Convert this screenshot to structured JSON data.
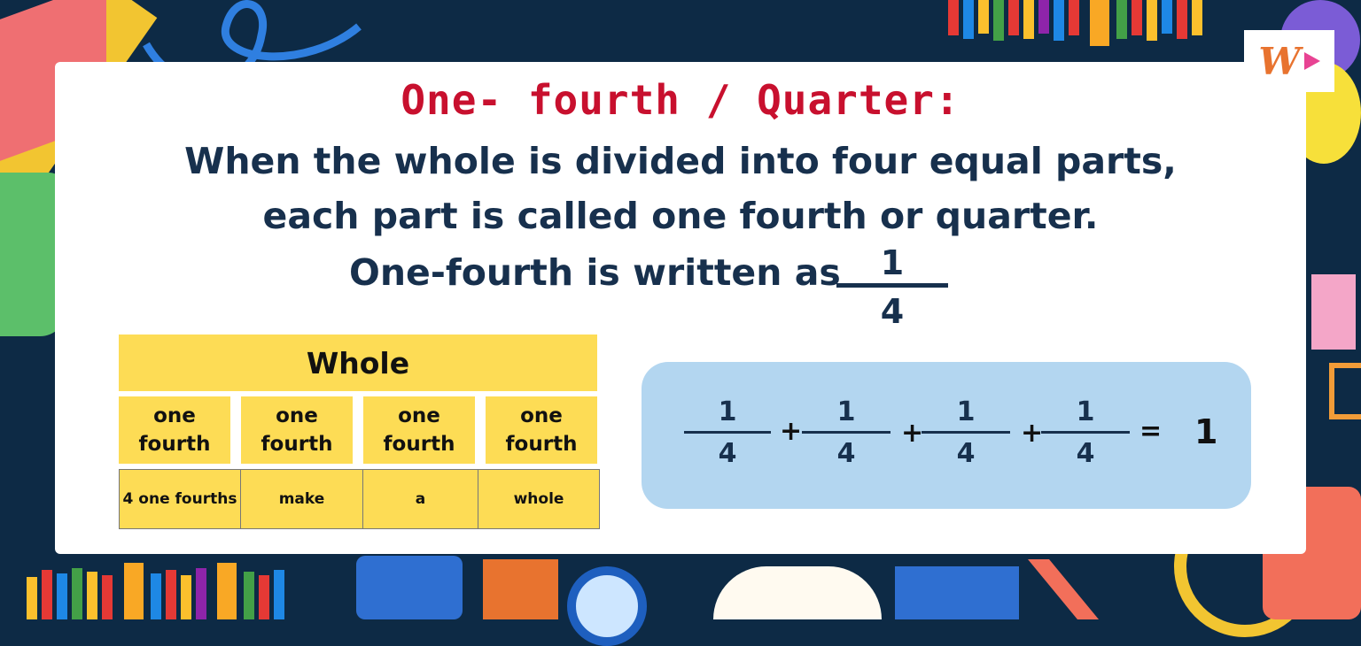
{
  "title": "One- fourth / Quarter:",
  "definition": {
    "line1": "When the whole is divided into four equal parts,",
    "line2": "each part is called one fourth or quarter.",
    "written_as": "One-fourth is written as"
  },
  "main_fraction": {
    "numerator": "1",
    "denominator": "4"
  },
  "fraction_table": {
    "header": "Whole",
    "parts": [
      "one fourth",
      "one fourth",
      "one fourth",
      "one fourth"
    ],
    "footer": [
      "4 one fourths",
      "make",
      "a",
      "whole"
    ]
  },
  "equation": {
    "terms": [
      {
        "numerator": "1",
        "denominator": "4"
      },
      {
        "numerator": "1",
        "denominator": "4"
      },
      {
        "numerator": "1",
        "denominator": "4"
      },
      {
        "numerator": "1",
        "denominator": "4"
      }
    ],
    "plus": "+",
    "equals": "=",
    "result": "1"
  },
  "logo": {
    "letter": "W"
  },
  "colors": {
    "background": "#0d2a45",
    "title": "#c8102e",
    "text": "#17304d",
    "table_fill": "#fddc55",
    "equation_box": "#b3d6f0"
  }
}
